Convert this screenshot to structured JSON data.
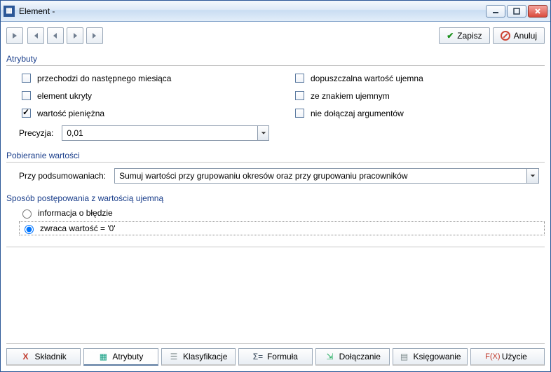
{
  "window": {
    "title": "Element -"
  },
  "toolbar": {
    "save": "Zapisz",
    "cancel": "Anuluj"
  },
  "sections": {
    "attributes": "Atrybuty",
    "valueFetch": "Pobieranie wartości",
    "negHandling": "Sposób postępowania z wartością ujemną"
  },
  "checks": {
    "nextMonth": "przechodzi do następnego miesiąca",
    "hidden": "element ukryty",
    "monetary": "wartość pieniężna",
    "allowNeg": "dopuszczalna wartość ujemna",
    "negSign": "ze znakiem ujemnym",
    "noArgs": "nie dołączaj argumentów"
  },
  "precision": {
    "label": "Precyzja:",
    "value": "0,01"
  },
  "summary": {
    "label": "Przy podsumowaniach:",
    "value": "Sumuj wartości przy grupowaniu okresów oraz przy grupowaniu pracowników"
  },
  "neg": {
    "errorInfo": "informacja o błędzie",
    "returnZero": "zwraca wartość = '0'"
  },
  "tabs": {
    "component": "Składnik",
    "attributes": "Atrybuty",
    "classifications": "Klasyfikacje",
    "formula": "Formuła",
    "attach": "Dołączanie",
    "accounting": "Księgowanie",
    "usage": "Użycie"
  }
}
